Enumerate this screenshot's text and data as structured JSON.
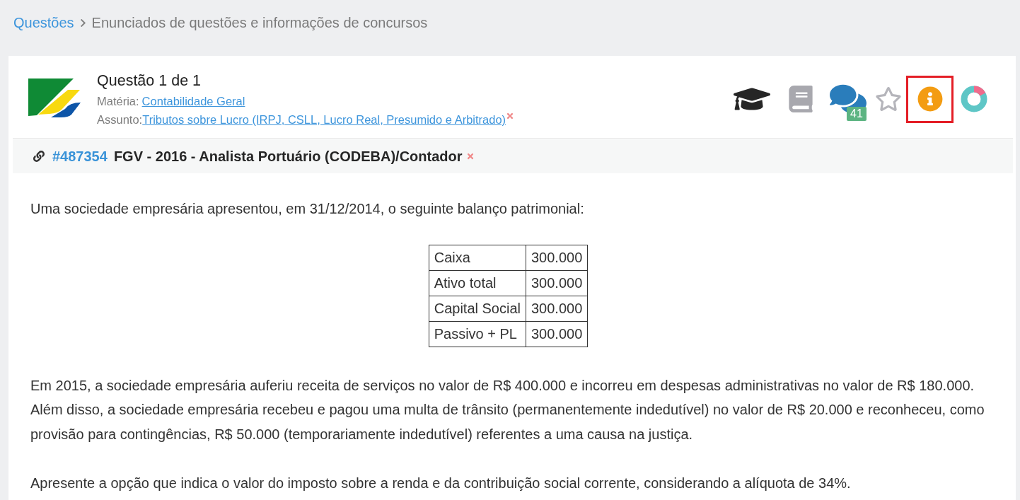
{
  "breadcrumb": [
    {
      "kind": "link",
      "label": "Questões"
    },
    {
      "kind": "current",
      "label": "Enunciados de questões e informações de concursos"
    }
  ],
  "question": {
    "title": "Questão 1 de 1",
    "subject_label": "Matéria:",
    "subject": "Contabilidade Geral",
    "topic_label": "Assunto:",
    "topic": "Tributos sobre Lucro (IRPJ, CSLL, Lucro Real, Presumido e Arbitrado)"
  },
  "toolbar": [
    {
      "kind": "course",
      "highlighted": false
    },
    {
      "kind": "notebook",
      "highlighted": false
    },
    {
      "kind": "comments",
      "badge": "41",
      "highlighted": false
    },
    {
      "kind": "favorite",
      "highlighted": false
    },
    {
      "kind": "info",
      "highlighted": true
    },
    {
      "kind": "stats",
      "highlighted": false
    }
  ],
  "exam": {
    "id": "#487354",
    "title": "FGV - 2016 - Analista Portuário (CODEBA)/Contador"
  },
  "statement": [
    {
      "kind": "paragraph",
      "text": "Uma sociedade empresária apresentou, em 31/12/2014, o seguinte balanço patrimonial:"
    },
    {
      "kind": "table",
      "rows": [
        [
          "Caixa",
          "300.000"
        ],
        [
          "Ativo total",
          "300.000"
        ],
        [
          "Capital Social",
          "300.000"
        ],
        [
          "Passivo + PL",
          "300.000"
        ]
      ]
    },
    {
      "kind": "paragraph",
      "text": "Em 2015, a sociedade empresária auferiu receita de serviços no valor de R$ 400.000 e incorreu em despesas administrativas no valor de R$ 180.000. Além disso, a sociedade empresária recebeu e pagou uma multa de trânsito (permanentemente indedutível) no valor de R$ 20.000 e reconheceu, como provisão para contingências, R$ 50.000 (temporariamente indedutível) referentes a uma causa na justiça."
    },
    {
      "kind": "paragraph",
      "text": "Apresente a opção que indica o valor do imposto sobre a renda e da contribuição social corrente, considerando a alíquota de 34%."
    }
  ]
}
